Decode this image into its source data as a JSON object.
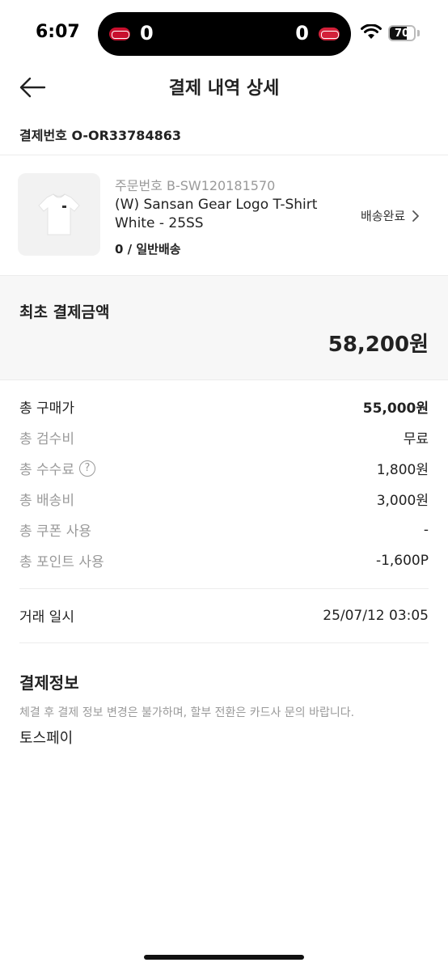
{
  "status_bar": {
    "time": "6:07",
    "score_left": "0",
    "score_right": "0",
    "battery": "70",
    "battery_level": 0.7
  },
  "header": {
    "title": "결제 내역 상세"
  },
  "payment_number": "결제번호 O-OR33784863",
  "product": {
    "order_number": "주문번호 B-SW120181570",
    "name": "(W) Sansan Gear Logo T-Shirt White - 25SS",
    "option": "0 / 일반배송",
    "status": "배송완료"
  },
  "summary": {
    "label": "최초 결제금액",
    "amount": "58,200원"
  },
  "rows": [
    {
      "label": "총 구매가",
      "value": "55,000원"
    },
    {
      "label": "총 검수비",
      "value": "무료"
    },
    {
      "label": "총 수수료",
      "value": "1,800원"
    },
    {
      "label": "총 배송비",
      "value": "3,000원"
    },
    {
      "label": "총 쿠폰 사용",
      "value": "-"
    },
    {
      "label": "총 포인트 사용",
      "value": "-1,600P"
    }
  ],
  "transaction": {
    "label": "거래 일시",
    "value": "25/07/12 03:05"
  },
  "payment_info": {
    "title": "결제정보",
    "note": "체결 후 결제 정보 변경은 불가하며, 할부 전환은 카드사 문의 바랍니다.",
    "method": "토스페이"
  }
}
